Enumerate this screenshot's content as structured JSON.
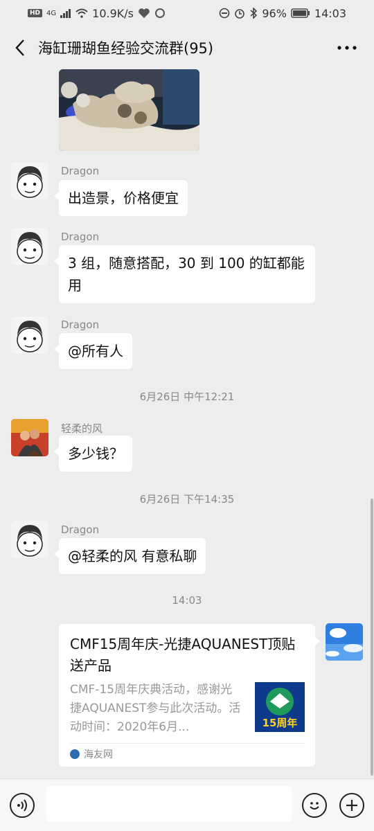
{
  "status": {
    "left_badges": [
      "HD",
      "4G"
    ],
    "speed": "10.9K/s",
    "battery": "96%",
    "time": "14:03"
  },
  "header": {
    "back_icon": "chevron-left-icon",
    "title": "海缸珊瑚鱼经验交流群(95)",
    "more_icon": "more-dots-icon"
  },
  "messages": {
    "m1": {
      "sender": "Dragon",
      "text": "出造景，价格便宜"
    },
    "m2": {
      "sender": "Dragon",
      "text": "3 组，随意搭配，30 到 100 的缸都能用"
    },
    "m3": {
      "sender": "Dragon",
      "text": "@所有人"
    },
    "t1": "6月26日 中午12:21",
    "m4": {
      "sender": "轻柔的风",
      "text": "多少钱？"
    },
    "t2": "6月26日 下午14:35",
    "m5": {
      "sender": "Dragon",
      "text": "@轻柔的风  有意私聊"
    },
    "t3": "14:03"
  },
  "card": {
    "title": "CMF15周年庆-光捷AQUANEST顶贴送产品",
    "desc": "CMF-15周年庆典活动，感谢光捷AQUANEST参与此次活动。活动时间：2020年6月...",
    "thumb_text": "15周年",
    "source": "海友网"
  },
  "inputbar": {
    "voice_icon": "voice-icon",
    "emoji_icon": "emoji-icon",
    "plus_icon": "plus-icon"
  },
  "colors": {
    "background": "#ededed",
    "bubble": "#ffffff",
    "timestamp": "#888888"
  }
}
